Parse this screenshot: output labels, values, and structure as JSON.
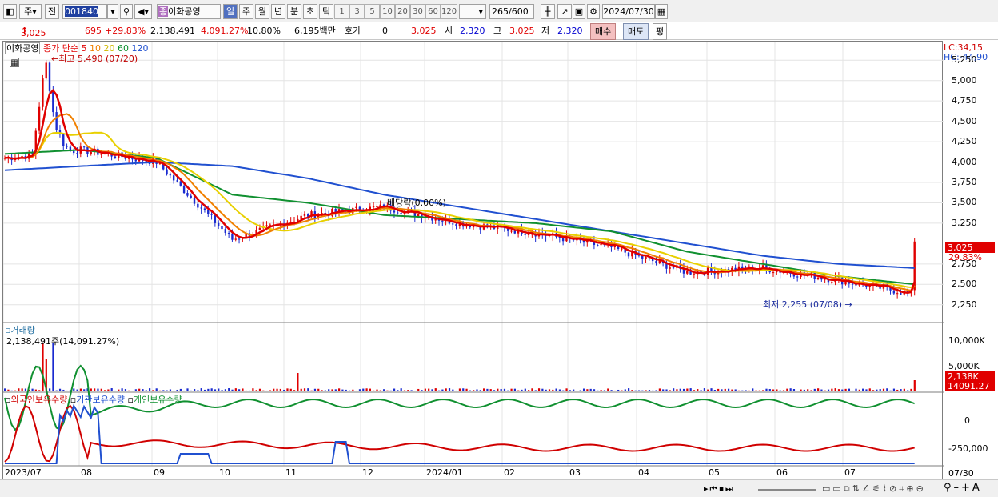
{
  "toolbar": {
    "market": "주",
    "prev": "전",
    "code": "001840",
    "name": "이화공영",
    "badge": "종",
    "periods": [
      "일",
      "주",
      "월",
      "년",
      "분",
      "초",
      "틱"
    ],
    "nums": [
      "1",
      "3",
      "5",
      "10",
      "20",
      "30",
      "60",
      "120"
    ],
    "count": "265",
    "total": "/600",
    "date": "2024/07/30"
  },
  "quote": {
    "price": "3,025",
    "change": "695",
    "change_pct": "+29.83%",
    "volume": "2,138,491",
    "vol_ratio": "4,091.27%",
    "turnover": "10.80%",
    "amount": "6,195백만",
    "hoga_label": "호가",
    "hoga_val": "0",
    "hoga_price": "3,025",
    "open_label": "시",
    "open": "2,320",
    "high_label": "고",
    "high": "3,025",
    "low_label": "저",
    "low": "2,320",
    "buy": "매수",
    "sell": "매도",
    "pyeong": "평"
  },
  "legend": {
    "stock": "이화공영",
    "ma_label": "종가 단순",
    "ma": [
      "5",
      "10",
      "20",
      "60",
      "120"
    ],
    "ma_colors": [
      "#e00000",
      "#f08000",
      "#e8d000",
      "#109030",
      "#2050d0"
    ]
  },
  "annotations": {
    "high": "←최고 5,490 (07/20)",
    "low": "최저 2,255 (07/08) →",
    "dividend": "배당락(0.00%)"
  },
  "axis_right": {
    "lc": "LC:34,15",
    "hc": "HC:-44,90",
    "price_ticks": [
      "5,250",
      "5,000",
      "4,750",
      "4,500",
      "4,250",
      "4,000",
      "3,750",
      "3,500",
      "3,250",
      "2,750",
      "2,500",
      "2,250"
    ],
    "cur_price": "3,025",
    "cur_pct": "29.83%",
    "vol_ticks": [
      "10,000K",
      "5,000K"
    ],
    "cur_vol": "2,138K",
    "cur_vol_pct": "14091.27",
    "inv_ticks": [
      "0",
      "-250,000"
    ],
    "x_last": "07/30"
  },
  "volume_panel": {
    "title": "거래량",
    "value": "2,138,491주(14,091.27%)"
  },
  "investor_panel": {
    "foreign": "외국인보유수량",
    "inst": "기관보유수량",
    "indiv": "개인보유수량"
  },
  "x_labels": [
    "2023/07",
    "08",
    "09",
    "10",
    "11",
    "12",
    "2024/01",
    "02",
    "03",
    "04",
    "05",
    "06",
    "07"
  ],
  "chart_data": {
    "type": "candlestick",
    "title": "이화공영",
    "x": [
      "2023-07",
      "2023-08",
      "2023-09",
      "2023-10",
      "2023-11",
      "2023-12",
      "2024-01",
      "2024-02",
      "2024-03",
      "2024-04",
      "2024-05",
      "2024-06",
      "2024-07-30"
    ],
    "close": [
      4050,
      4150,
      4000,
      3050,
      3350,
      3450,
      3250,
      3130,
      2950,
      2650,
      2700,
      2550,
      3025
    ],
    "ma120": [
      3900,
      3950,
      4000,
      3950,
      3800,
      3600,
      3450,
      3300,
      3150,
      3000,
      2850,
      2750,
      2700
    ],
    "ma60": [
      4100,
      4150,
      4050,
      3600,
      3500,
      3350,
      3300,
      3250,
      3150,
      2900,
      2750,
      2600,
      2500
    ],
    "high_note": {
      "date": "07/20",
      "value": 5490
    },
    "low_note": {
      "date": "07/08",
      "value": 2255
    },
    "ylim": [
      2100,
      5400
    ]
  }
}
